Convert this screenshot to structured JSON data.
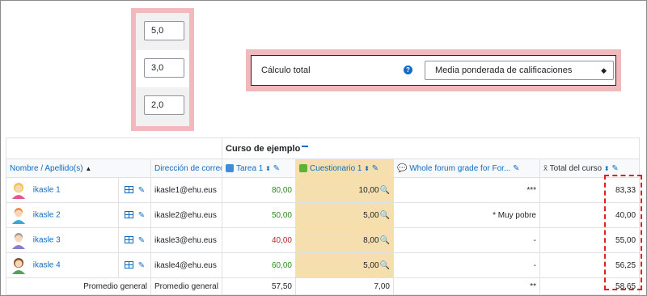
{
  "weights": {
    "values": [
      "5,0",
      "3,0",
      "2,0"
    ]
  },
  "total_calc": {
    "label": "Cálculo total",
    "help": "?",
    "select_value": "Media ponderada de calificaciones"
  },
  "table": {
    "course": "Curso de ejemplo",
    "headers": {
      "name": "Nombre / Apellido(s)",
      "email": "Dirección de correo",
      "task": "Tarea 1",
      "quiz": "Cuestionario 1",
      "forum": "Whole forum grade for For...",
      "total": "Total del curso"
    },
    "rows": [
      {
        "name": "ikasle 1",
        "email": "ikasle1@ehu.eus",
        "task": "80,00",
        "quiz": "10,00",
        "forum": "***",
        "total": "83,33"
      },
      {
        "name": "ikasle 2",
        "email": "ikasle2@ehu.eus",
        "task": "50,00",
        "quiz": "5,00",
        "forum": "* Muy pobre",
        "total": "40,00"
      },
      {
        "name": "ikasle 3",
        "email": "ikasle3@ehu.eus",
        "task": "40,00",
        "quiz": "8,00",
        "forum": "-",
        "total": "55,00"
      },
      {
        "name": "ikasle 4",
        "email": "ikasle4@ehu.eus",
        "task": "60,00",
        "quiz": "5,00",
        "forum": "-",
        "total": "56,25"
      }
    ],
    "average": {
      "label_name": "Promedio general",
      "label_email": "Promedio general",
      "task": "57,50",
      "quiz": "7,00",
      "forum": "**",
      "total": "58,65"
    },
    "colors": {
      "green": "#2e8b1f",
      "red": "#b12a2a",
      "highlight": "#f6dfae",
      "link": "#0f6cbf"
    }
  }
}
